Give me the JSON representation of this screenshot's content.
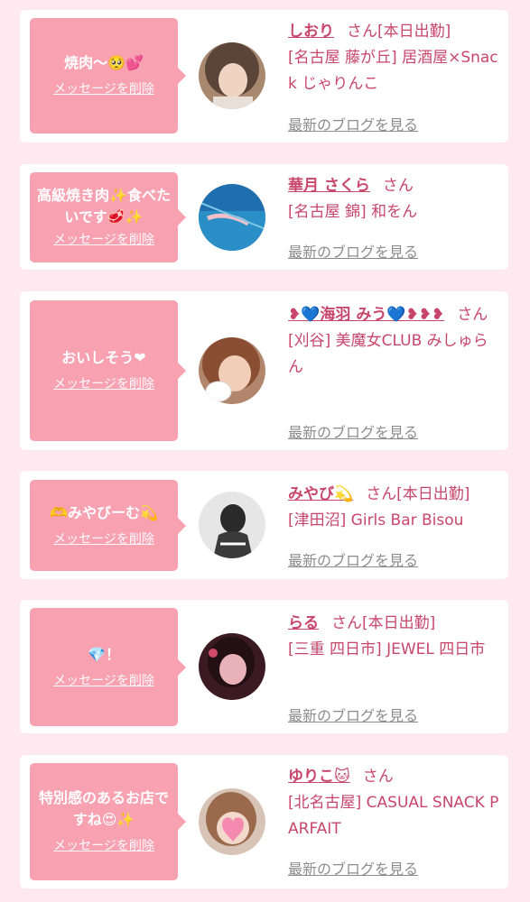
{
  "colors": {
    "page_bg": "#fde9ef",
    "card_bg": "#ffffff",
    "bubble_bg": "#f7a1b1",
    "name_color": "#c8466c",
    "link_gray": "#8c8c8c"
  },
  "entries": [
    {
      "message": "焼肉〜🥺💕",
      "delete_label": "メッセージを削除",
      "name": "しおり",
      "suffix": "さん",
      "status": "[本日出勤]",
      "shop": "[名古屋 藤が丘] 居酒屋×Snack じゃりんこ",
      "blog_label": "最新のブログを見る"
    },
    {
      "message": "高級焼き肉✨食べたいです🥩✨",
      "delete_label": "メッセージを削除",
      "name": "華月 さくら",
      "suffix": "さん",
      "status": "",
      "shop": "[名古屋 錦] 和をん",
      "blog_label": "最新のブログを見る"
    },
    {
      "message": "おいしそう❤︎",
      "delete_label": "メッセージを削除",
      "name": "❥💙海羽 みう💙❥❥❥",
      "suffix": "さん",
      "status": "",
      "shop": "[刈谷] 美魔女CLUB みしゅらん",
      "blog_label": "最新のブログを見る"
    },
    {
      "message": "🫶みやびーむ💫",
      "delete_label": "メッセージを削除",
      "name": "みやび💫",
      "suffix": "さん",
      "status": "[本日出勤]",
      "shop": "[津田沼] Girls Bar Bisou",
      "blog_label": "最新のブログを見る"
    },
    {
      "message": "💎！",
      "delete_label": "メッセージを削除",
      "name": "らる",
      "suffix": "さん",
      "status": "[本日出勤]",
      "shop": "[三重 四日市] JEWEL 四日市",
      "blog_label": "最新のブログを見る"
    },
    {
      "message": "特別感のあるお店ですね😍✨",
      "delete_label": "メッセージを削除",
      "name": "ゆりこ🐱",
      "suffix": "さん",
      "status": "",
      "shop": "[北名古屋] CASUAL SNACK PARFAIT",
      "blog_label": "最新のブログを見る"
    }
  ]
}
